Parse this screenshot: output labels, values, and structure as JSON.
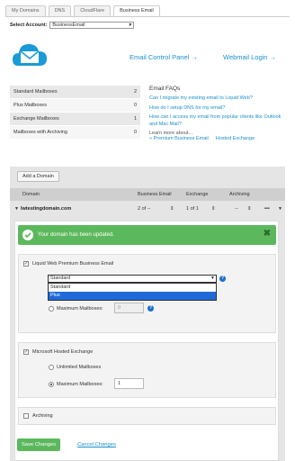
{
  "tabs": [
    "My Domains",
    "DNS",
    "CloudFlare",
    "Business Email"
  ],
  "account": {
    "label": "Select Account:",
    "value": "BusinessEmail"
  },
  "header": {
    "control_panel": "Email Control Panel →",
    "webmail": "Webmail Login →"
  },
  "stats": [
    {
      "label": "Standard Mailboxes",
      "value": "2"
    },
    {
      "label": "Plus Mailboxes",
      "value": "0"
    },
    {
      "label": "Exchange Mailboxes",
      "value": "1"
    },
    {
      "label": "Mailboxes with Archiving",
      "value": "0"
    }
  ],
  "faq": {
    "title": "Email FAQs",
    "links": [
      "Can I migrate my existing email to Liquid Web?",
      "How do I setup DNS for my email?",
      "How can I access my email from popular clients like Outlook and Mac Mail?"
    ],
    "learn_more": "Learn more about...",
    "learn_links": [
      "» Premium Business Email",
      "Hosted Exchange"
    ]
  },
  "domains": {
    "add_button": "Add a Domain",
    "headers": {
      "domain": "Domain",
      "business_email": "Business Email",
      "exchange": "Exchange",
      "archiving": "Archiving"
    },
    "row": {
      "name": "lwtestingdomain.com",
      "business_email": "2 of --",
      "exchange": "1 of 1",
      "archiving": "--"
    }
  },
  "success": {
    "message": "Your domain has been updated."
  },
  "premium": {
    "title": "Liquid Web Premium Business Email",
    "selected": "Standard",
    "options": [
      "Standard",
      "Plus"
    ],
    "max_label": "Maximum Mailboxes:",
    "max_value": "0"
  },
  "exchange": {
    "title": "Microsoft Hosted Exchange",
    "unlimited": "Unlimited Mailboxes",
    "max_label": "Maximum Mailboxes:",
    "max_value": "1"
  },
  "archiving": {
    "title": "Archiving"
  },
  "actions": {
    "save": "Save Changes",
    "cancel": "Cancel Changes"
  }
}
